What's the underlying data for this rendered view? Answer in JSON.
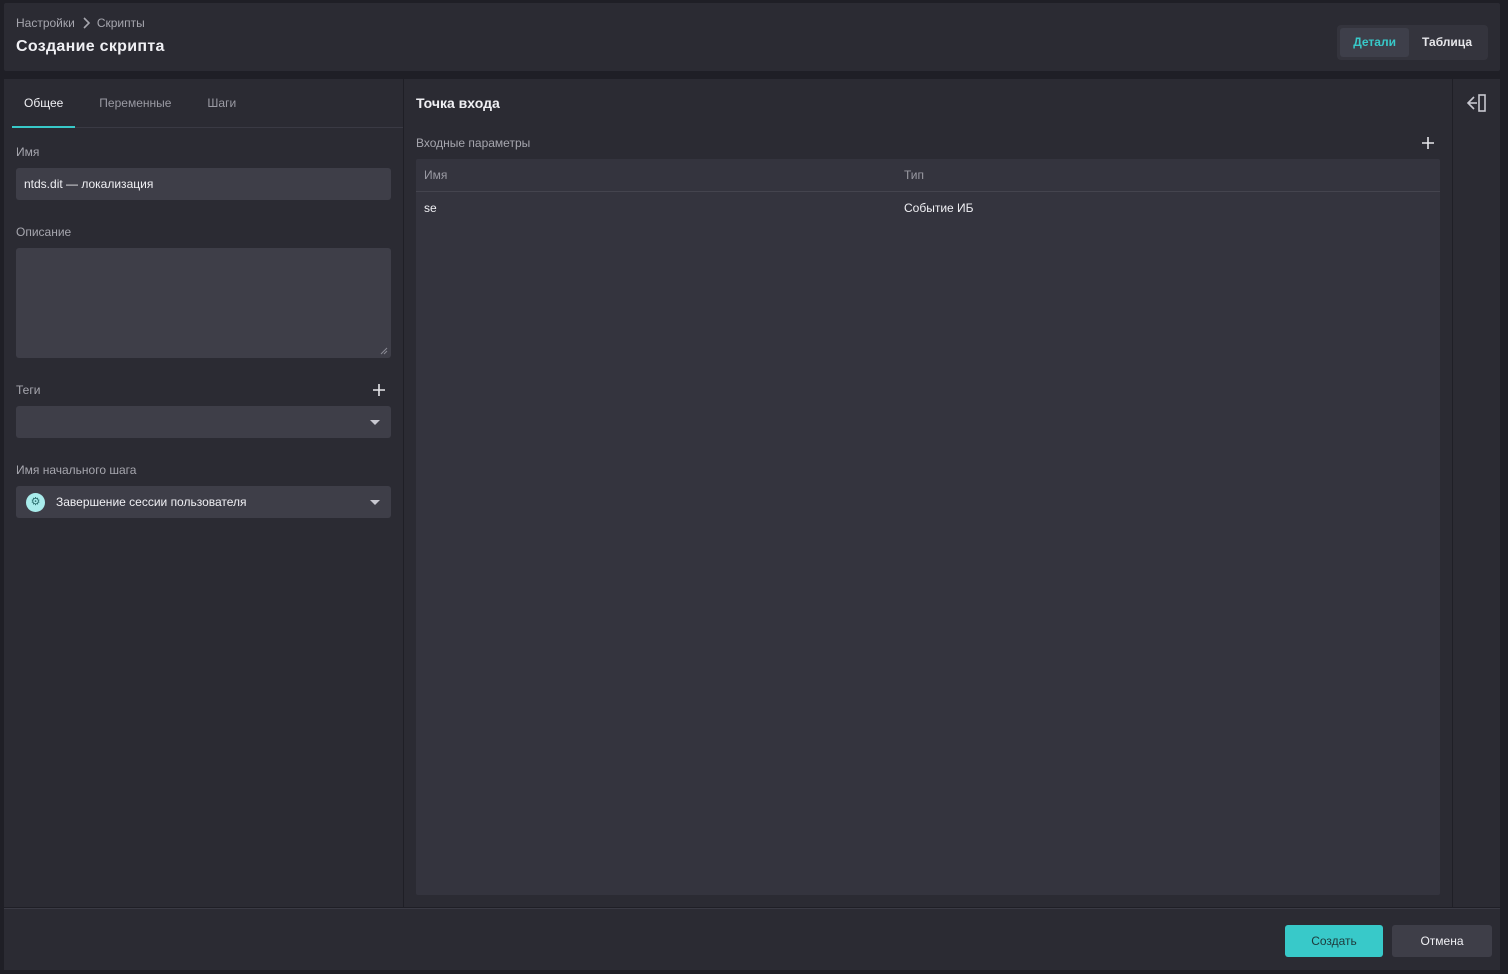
{
  "header": {
    "breadcrumb": [
      "Настройки",
      "Скрипты"
    ],
    "title": "Создание скрипта",
    "view_switch": {
      "details": "Детали",
      "table": "Таблица",
      "active": "details"
    }
  },
  "left_panel": {
    "tabs": [
      {
        "label": "Общее",
        "active": true
      },
      {
        "label": "Переменные",
        "active": false
      },
      {
        "label": "Шаги",
        "active": false
      }
    ],
    "name": {
      "label": "Имя",
      "value": "ntds.dit — локализация"
    },
    "description": {
      "label": "Описание",
      "value": ""
    },
    "tags": {
      "label": "Теги",
      "value": ""
    },
    "start_step": {
      "label": "Имя начального шага",
      "value": "Завершение сессии пользователя",
      "icon": "gear-icon"
    }
  },
  "center_panel": {
    "title": "Точка входа",
    "params_label": "Входные параметры",
    "table": {
      "columns": [
        "Имя",
        "Тип"
      ],
      "rows": [
        {
          "name": "se",
          "type": "Событие ИБ"
        }
      ]
    }
  },
  "footer": {
    "create_label": "Создать",
    "cancel_label": "Отмена"
  },
  "colors": {
    "accent": "#38c9c9",
    "background": "#1f1f26",
    "panel": "#2b2b33",
    "input": "#3e3e48"
  }
}
